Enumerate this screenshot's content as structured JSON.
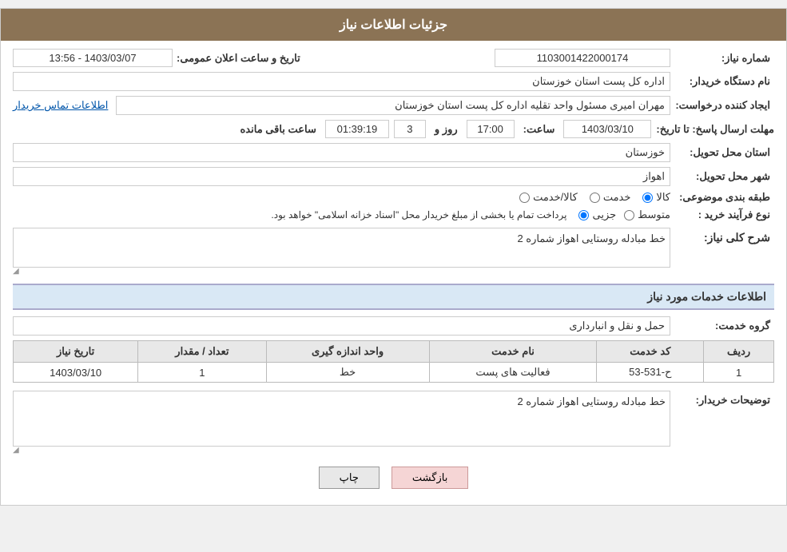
{
  "header": {
    "title": "جزئیات اطلاعات نیاز"
  },
  "fields": {
    "need_number_label": "شماره نیاز:",
    "need_number_value": "1103001422000174",
    "org_name_label": "نام دستگاه خریدار:",
    "org_name_value": "اداره کل پست استان خوزستان",
    "creator_label": "ایجاد کننده درخواست:",
    "creator_value": "مهران امیری مسئول واحد تقلیه اداره کل پست استان خوزستان",
    "contact_link": "اطلاعات تماس خریدار",
    "deadline_label": "مهلت ارسال پاسخ: تا تاریخ:",
    "deadline_date": "1403/03/10",
    "deadline_time_label": "ساعت:",
    "deadline_time": "17:00",
    "deadline_days_label": "روز و",
    "deadline_days": "3",
    "deadline_remaining_label": "ساعت باقی مانده",
    "deadline_remaining": "01:39:19",
    "province_label": "استان محل تحویل:",
    "province_value": "خوزستان",
    "city_label": "شهر محل تحویل:",
    "city_value": "اهواز",
    "category_label": "طبقه بندی موضوعی:",
    "category_options": [
      "کالا",
      "خدمت",
      "کالا/خدمت"
    ],
    "category_selected": "کالا",
    "purchase_label": "نوع فرآیند خرید :",
    "purchase_options": [
      "جزیی",
      "متوسط"
    ],
    "purchase_note": "پرداخت تمام یا بخشی از مبلغ خریدار محل \"اسناد خزانه اسلامی\" خواهد بود.",
    "need_desc_label": "شرح کلی نیاز:",
    "need_desc_value": "خط مبادله روستایی اهواز شماره 2",
    "services_section": "اطلاعات خدمات مورد نیاز",
    "service_group_label": "گروه خدمت:",
    "service_group_value": "حمل و نقل و انبارداری",
    "table": {
      "headers": [
        "ردیف",
        "کد خدمت",
        "نام خدمت",
        "واحد اندازه گیری",
        "تعداد / مقدار",
        "تاریخ نیاز"
      ],
      "rows": [
        {
          "row": "1",
          "code": "ح-531-53",
          "name": "فعالیت های پست",
          "unit": "خط",
          "quantity": "1",
          "date": "1403/03/10"
        }
      ]
    },
    "buyer_desc_label": "توضیحات خریدار:",
    "buyer_desc_value": "خط مبادله روستایی اهواز شماره 2"
  },
  "buttons": {
    "print": "چاپ",
    "back": "بازگشت"
  },
  "date_announce_label": "تاریخ و ساعت اعلان عمومی:"
}
